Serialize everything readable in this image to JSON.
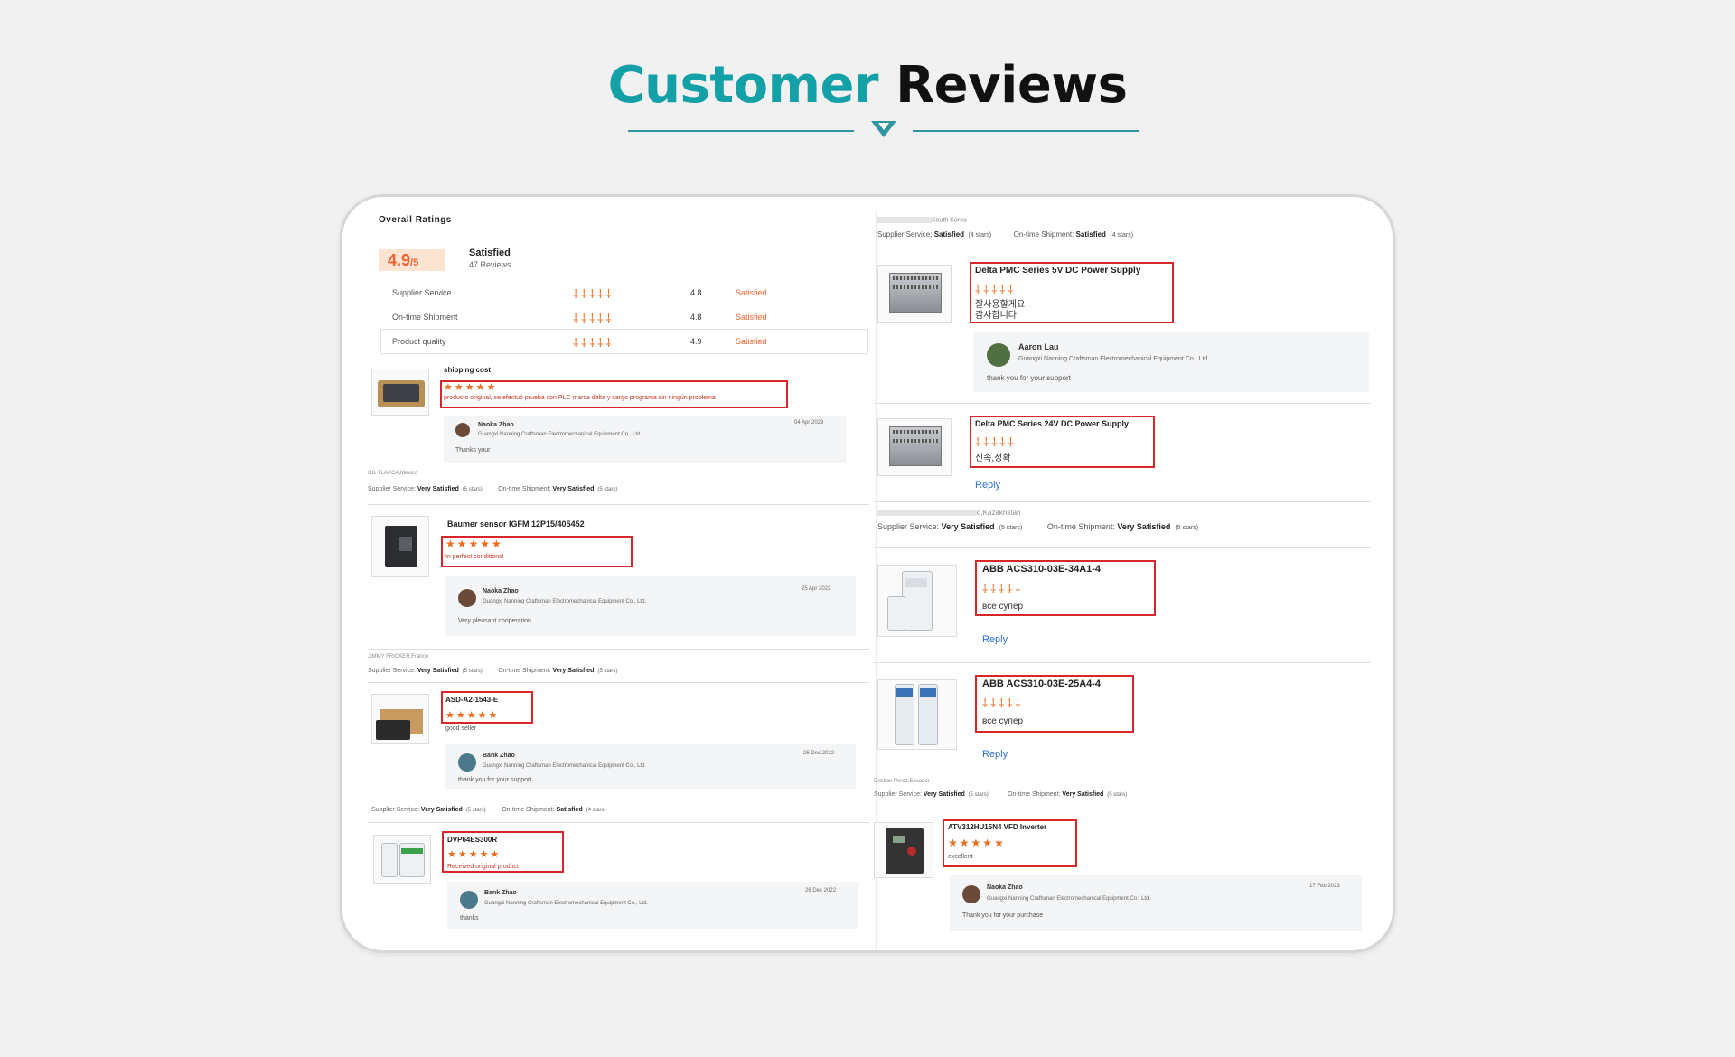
{
  "header": {
    "title_part1": "Customer",
    "title_part2": "Reviews"
  },
  "overall": {
    "heading": "Overall Ratings",
    "score": "4.9",
    "score_suffix": "/5",
    "summary": "Satisfied",
    "reviews_count": "47 Reviews",
    "rows": [
      {
        "label": "Supplier Service",
        "value": "4.8",
        "status": "Satisfied"
      },
      {
        "label": "On-time Shipment",
        "value": "4.8",
        "status": "Satisfied"
      },
      {
        "label": "Product quality",
        "value": "4.9",
        "status": "Satisfied"
      }
    ]
  },
  "left_reviews": [
    {
      "product": "shipping cost",
      "stars": "★★★★★",
      "text": "producto original, se efectuó prueba con PLC marca delta y cargo programa sin ningún problema",
      "reply_name": "Naoka Zhao",
      "reply_company": "Guangxi Nanning Craftsman Electromechanical Equipment Co., Ltd.",
      "reply_date": "04 Apr 2023",
      "reply_text": "Thanks your",
      "meta_location": "GIL TLAXCA,Mexico",
      "meta_supplier_label": "Supplier Service:",
      "meta_supplier_value": "Very Satisfied",
      "meta_supplier_stars": "(5 stars)",
      "meta_ship_label": "On-time Shipment:",
      "meta_ship_value": "Very Satisfied",
      "meta_ship_stars": "(5 stars)"
    },
    {
      "product": "Baumer sensor IGFM 12P15/405452",
      "stars": "★★★★★",
      "text": "In perfect conditions!",
      "reply_name": "Naoka Zhao",
      "reply_company": "Guangxi Nanning Craftsman Electromechanical Equipment Co., Ltd.",
      "reply_date": "25 Apr 2022",
      "reply_text": "Very pleasant cooperation",
      "meta_location": "JIMMY FRICKER,France",
      "meta_supplier_label": "Supplier Service:",
      "meta_supplier_value": "Very Satisfied",
      "meta_supplier_stars": "(5 stars)",
      "meta_ship_label": "On-time Shipment:",
      "meta_ship_value": "Very Satisfied",
      "meta_ship_stars": "(5 stars)"
    },
    {
      "product": "ASD-A2-1543-E",
      "stars": "★★★★★",
      "text": "good seller",
      "reply_name": "Bank Zhao",
      "reply_company": "Guangxi Nanning Craftsman Electromechanical Equipment Co., Ltd.",
      "reply_date": "26 Dec 2022",
      "reply_text": "thank you for your support",
      "meta_supplier_label": "Supplier Service:",
      "meta_supplier_value": "Very Satisfied",
      "meta_supplier_stars": "(5 stars)",
      "meta_ship_label": "On-time Shipment:",
      "meta_ship_value": "Satisfied",
      "meta_ship_stars": "(4 stars)"
    },
    {
      "product": "DVP64ES300R",
      "stars": "★★★★★",
      "text": "Received original product",
      "reply_name": "Bank Zhao",
      "reply_company": "Guangxi Nanning Craftsman Electromechanical Equipment Co., Ltd.",
      "reply_date": "26 Dec 2022",
      "reply_text": "thanks"
    }
  ],
  "right_top_meta": {
    "location": "South Korea",
    "supplier_label": "Supplier Service:",
    "supplier_value": "Satisfied",
    "supplier_stars": "(4 stars)",
    "ship_label": "On-time Shipment:",
    "ship_value": "Satisfied",
    "ship_stars": "(4 stars)"
  },
  "right_reviews": [
    {
      "product": "Delta PMC Series 5V DC Power Supply",
      "stars": "⸸⸸⸸⸸⸸",
      "text1": "잘사용할게요",
      "text2": "감사합니다",
      "reply_name": "Aaron Lau",
      "reply_company": "Guangxi Nanning Craftsman Electromechanical Equipment Co., Ltd.",
      "reply_text": "thank you for your support"
    },
    {
      "product": "Delta PMC Series 24V DC Power Supply",
      "stars": "⸸⸸⸸⸸⸸",
      "text1": "신속,정확",
      "reply_link": "Reply"
    }
  ],
  "right_mid_meta": {
    "location": "o,Kazakhstan",
    "supplier_label": "Supplier Service:",
    "supplier_value": "Very Satisfied",
    "supplier_stars": "(5 stars)",
    "ship_label": "On-time Shipment:",
    "ship_value": "Very Satisfied",
    "ship_stars": "(5 stars)"
  },
  "right_reviews2": [
    {
      "product": "ABB ACS310-03E-34A1-4",
      "stars": "⸸⸸⸸⸸⸸",
      "text": "все супер",
      "reply_link": "Reply"
    },
    {
      "product": "ABB ACS310-03E-25A4-4",
      "stars": "⸸⸸⸸⸸⸸",
      "text": "все супер",
      "reply_link": "Reply"
    }
  ],
  "right_bottom_meta": {
    "location": "Cristian Perez,Ecuador",
    "supplier_label": "Supplier Service:",
    "supplier_value": "Very Satisfied",
    "supplier_stars": "(5 stars)",
    "ship_label": "On-time Shipment:",
    "ship_value": "Very Satisfied",
    "ship_stars": "(5 stars)"
  },
  "right_last_review": {
    "product": "ATV312HU15N4 VFD Inverter",
    "stars": "★★★★★",
    "text": "excellent",
    "reply_name": "Naoka Zhao",
    "reply_company": "Guangxi Nanning Craftsman Electromechanical Equipment Co., Ltd.",
    "reply_date": "17 Feb 2023",
    "reply_text": "Thank you for your purchase"
  },
  "colors": {
    "teal": "#13a0a6",
    "line": "#2f95a0",
    "highlight_red": "#d9262b",
    "star_orange": "#f06a1c"
  }
}
